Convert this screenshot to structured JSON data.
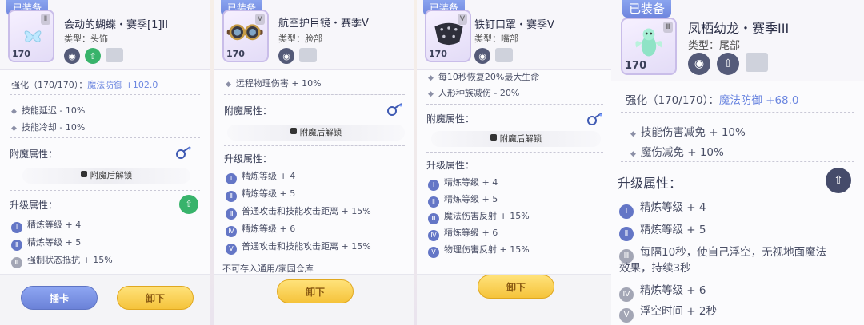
{
  "panels": [
    {
      "equipped_badge": "已装备",
      "level": "170",
      "rank": "Ⅱ",
      "title": "会动的蝴蝶・赛季[1]II",
      "type": "类型：头饰",
      "strength": {
        "label": "强化（170/170）：",
        "value": "魔法防御 +102.0"
      },
      "stats": [
        "技能延迟 - 10%",
        "技能冷却 - 10%"
      ],
      "enchant_title": "附魔属性：",
      "enchant_lock": "附魔后解锁",
      "upgrade_title": "升级属性：",
      "upgrades": [
        {
          "num": "Ⅰ",
          "text": "精炼等级 + 4"
        },
        {
          "num": "Ⅱ",
          "text": "精炼等级 + 5"
        },
        {
          "num": "Ⅲ",
          "text": "强制状态抵抗 + 15%"
        }
      ],
      "buttons": [
        "插卡",
        "卸下"
      ]
    },
    {
      "equipped_badge": "已装备",
      "level": "170",
      "rank": "Ⅴ",
      "title": "航空护目镜・赛季V",
      "type": "类型：脸部",
      "stats_top": [
        "远程物理伤害 + 10%"
      ],
      "enchant_title": "附魔属性：",
      "enchant_lock": "附魔后解锁",
      "upgrade_title": "升级属性：",
      "upgrades": [
        {
          "num": "Ⅰ",
          "text": "精炼等级 + 4"
        },
        {
          "num": "Ⅱ",
          "text": "精炼等级 + 5"
        },
        {
          "num": "Ⅲ",
          "text": "普通攻击和技能攻击距离 + 15%"
        },
        {
          "num": "Ⅳ",
          "text": "精炼等级 + 6"
        },
        {
          "num": "Ⅴ",
          "text": "普通攻击和技能攻击距离 + 15%"
        }
      ],
      "note": "不可存入通用/家园仓库",
      "buttons": [
        "卸下"
      ]
    },
    {
      "equipped_badge": "已装备",
      "level": "170",
      "rank": "Ⅴ",
      "title": "铁钉口罩・赛季V",
      "type": "类型：嘴部",
      "stats_top": [
        "每10秒恢复20%最大生命",
        "人形种族减伤 - 20%"
      ],
      "enchant_title": "附魔属性：",
      "enchant_lock": "附魔后解锁",
      "upgrade_title": "升级属性：",
      "upgrades": [
        {
          "num": "Ⅰ",
          "text": "精炼等级 + 4"
        },
        {
          "num": "Ⅱ",
          "text": "精炼等级 + 5"
        },
        {
          "num": "Ⅲ",
          "text": "魔法伤害反射 + 15%"
        },
        {
          "num": "Ⅳ",
          "text": "精炼等级 + 6"
        },
        {
          "num": "Ⅴ",
          "text": "物理伤害反射 + 15%"
        }
      ],
      "buttons": [
        "卸下"
      ]
    },
    {
      "equipped_badge": "已装备",
      "level": "170",
      "rank": "Ⅲ",
      "title": "凤栖幼龙・赛季III",
      "type": "类型：尾部",
      "strength": {
        "label": "强化（170/170）：",
        "value": "魔法防御 +68.0"
      },
      "stats": [
        "技能伤害减免 + 10%",
        "魔伤减免 + 10%"
      ],
      "upgrade_title": "升级属性：",
      "upgrades": [
        {
          "num": "Ⅰ",
          "text": "精炼等级 + 4"
        },
        {
          "num": "Ⅱ",
          "text": "精炼等级 + 5"
        },
        {
          "num": "Ⅲ",
          "text": "每隔10秒，使自己浮空，无视地面魔法"
        },
        {
          "num": "",
          "text": "效果，持续3秒"
        },
        {
          "num": "Ⅳ",
          "text": "精炼等级 + 6"
        },
        {
          "num": "Ⅴ",
          "text": "浮空时间 + 2秒"
        }
      ]
    }
  ],
  "colors": {
    "accent": "#6b86e0",
    "badge": "#7f97e8",
    "gold_button": "#f5c33b",
    "blue_button": "#7b92e4"
  }
}
